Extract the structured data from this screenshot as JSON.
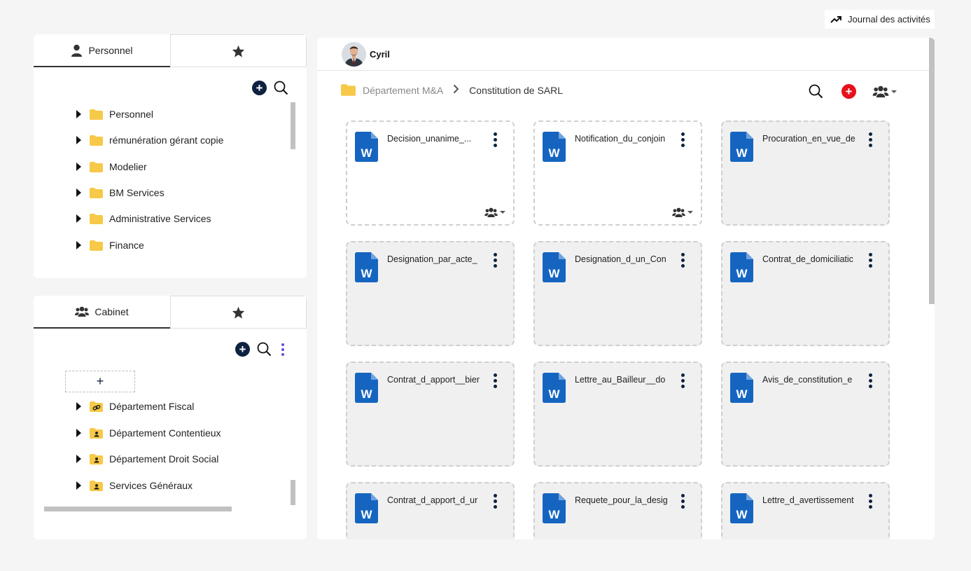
{
  "journal": {
    "label": "Journal des activités"
  },
  "personnel_panel": {
    "tab_label": "Personnel",
    "folders": [
      {
        "label": "Personnel"
      },
      {
        "label": "rémunération gérant copie"
      },
      {
        "label": "Modelier"
      },
      {
        "label": "BM Services"
      },
      {
        "label": "Administrative Services"
      },
      {
        "label": "Finance"
      }
    ]
  },
  "cabinet_panel": {
    "tab_label": "Cabinet",
    "add_node_label": "+",
    "folders": [
      {
        "label": "Département Fiscal",
        "icon": "shared-link-folder-icon"
      },
      {
        "label": "Département Contentieux",
        "icon": "user-folder-icon"
      },
      {
        "label": "Département Droit Social",
        "icon": "user-folder-icon"
      },
      {
        "label": "Services Généraux",
        "icon": "user-folder-icon"
      }
    ]
  },
  "main": {
    "user_name": "Cyril",
    "breadcrumb": {
      "parent": "Département M&A",
      "separator": ">",
      "current": "Constitution de SARL"
    },
    "documents": [
      {
        "name": "Decision_unanime_...",
        "shared": true
      },
      {
        "name": "Notification_du_conjoin",
        "shared": true
      },
      {
        "name": "Procuration_en_vue_de",
        "shared": false
      },
      {
        "name": "Designation_par_acte_",
        "shared": false
      },
      {
        "name": "Designation_d_un_Con",
        "shared": false
      },
      {
        "name": "Contrat_de_domiciliatic",
        "shared": false
      },
      {
        "name": "Contrat_d_apport__bier",
        "shared": false
      },
      {
        "name": "Lettre_au_Bailleur__do",
        "shared": false
      },
      {
        "name": "Avis_de_constitution_e",
        "shared": false
      },
      {
        "name": "Contrat_d_apport_d_ur",
        "shared": false
      },
      {
        "name": "Requete_pour_la_desig",
        "shared": false
      },
      {
        "name": "Lettre_d_avertissement",
        "shared": false
      }
    ]
  },
  "colors": {
    "navy": "#0e2240",
    "folder_yellow": "#f7c948",
    "word_blue": "#1565c0",
    "red_accent": "#e8101a",
    "purple_accent": "#6a4be0"
  }
}
